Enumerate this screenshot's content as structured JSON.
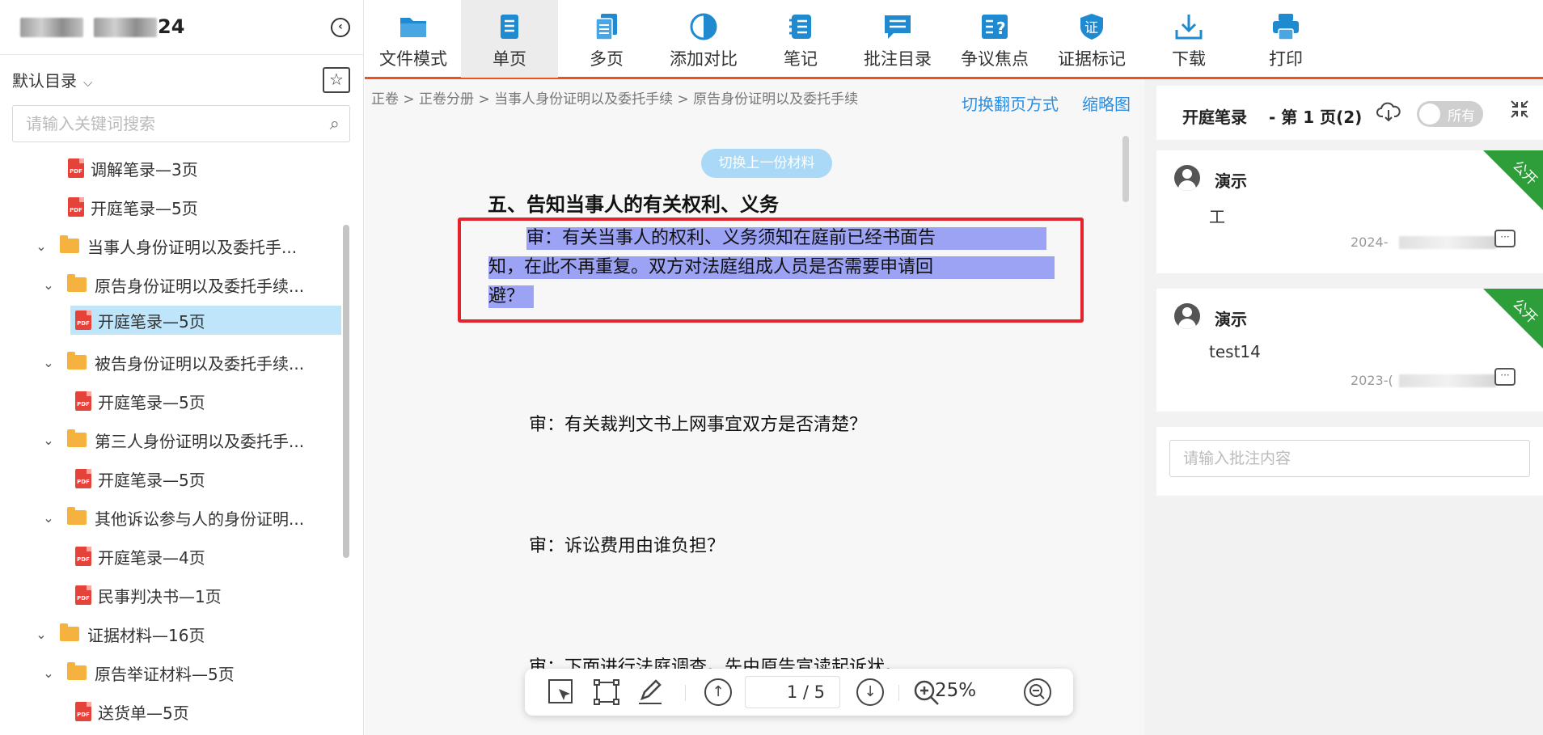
{
  "sidebar": {
    "case_name_suffix": "24",
    "catalog_label": "默认目录",
    "search_placeholder": "请输入关键词搜索",
    "items": [
      {
        "label": "调解笔录—3页",
        "type": "pdf"
      },
      {
        "label": "开庭笔录—5页",
        "type": "pdf"
      },
      {
        "label": "当事人身份证明以及委托手...",
        "type": "folder"
      },
      {
        "label": "原告身份证明以及委托手续...",
        "type": "folder"
      },
      {
        "label": "开庭笔录—5页",
        "type": "pdf",
        "selected": true
      },
      {
        "label": "被告身份证明以及委托手续...",
        "type": "folder"
      },
      {
        "label": "开庭笔录—5页",
        "type": "pdf"
      },
      {
        "label": "第三人身份证明以及委托手...",
        "type": "folder"
      },
      {
        "label": "开庭笔录—5页",
        "type": "pdf"
      },
      {
        "label": "其他诉讼参与人的身份证明...",
        "type": "folder"
      },
      {
        "label": "开庭笔录—4页",
        "type": "pdf"
      },
      {
        "label": "民事判决书—1页",
        "type": "pdf"
      },
      {
        "label": "证据材料—16页",
        "type": "folder"
      },
      {
        "label": "原告举证材料—5页",
        "type": "folder"
      },
      {
        "label": "送货单—5页",
        "type": "pdf"
      }
    ]
  },
  "toolbar": {
    "buttons": [
      {
        "label": "文件模式",
        "icon": "folder-icon"
      },
      {
        "label": "单页",
        "icon": "single-page-icon",
        "active": true
      },
      {
        "label": "多页",
        "icon": "multi-page-icon"
      },
      {
        "label": "添加对比",
        "icon": "compare-icon"
      },
      {
        "label": "笔记",
        "icon": "notes-icon"
      },
      {
        "label": "批注目录",
        "icon": "annotation-list-icon"
      },
      {
        "label": "争议焦点",
        "icon": "dispute-focus-icon"
      },
      {
        "label": "证据标记",
        "icon": "evidence-mark-icon"
      },
      {
        "label": "下载",
        "icon": "download-icon"
      },
      {
        "label": "打印",
        "icon": "print-icon"
      }
    ],
    "evidence_icon_char": "证",
    "accent": "#f0521f",
    "icon_color": "#1f8ad0"
  },
  "document": {
    "breadcrumb": "正卷 > 正卷分册 > 当事人身份证明以及委托手续 > 原告身份证明以及委托手续",
    "switch_mode": "切换翻页方式",
    "thumbnail": "缩略图",
    "prev_material": "切换上一份材料",
    "heading": "五、告知当事人的有关权利、义务",
    "highlight_lines": [
      "审：有关当事人的权利、义务须知在庭前已经书面告",
      "知，在此不再重复。双方对法庭组成人员是否需要申请回",
      "避？"
    ],
    "paragraphs": [
      "审：有关裁判文书上网事宜双方是否清楚？",
      "审：诉讼费用由谁负担？",
      "审：下面进行法庭调查。先由原告宣读起诉状。"
    ],
    "page_indicator": "1 / 5",
    "zoom": "25%"
  },
  "notes": {
    "title": "开庭笔录",
    "page_info": "- 第 1 页(2)",
    "toggle_label": "所有",
    "public_badge": "公开",
    "cards": [
      {
        "author": "演示",
        "content": "工",
        "date_prefix": "2024-"
      },
      {
        "author": "演示",
        "content": "test14",
        "date_prefix": "2023-("
      }
    ],
    "input_placeholder": "请输入批注内容"
  }
}
